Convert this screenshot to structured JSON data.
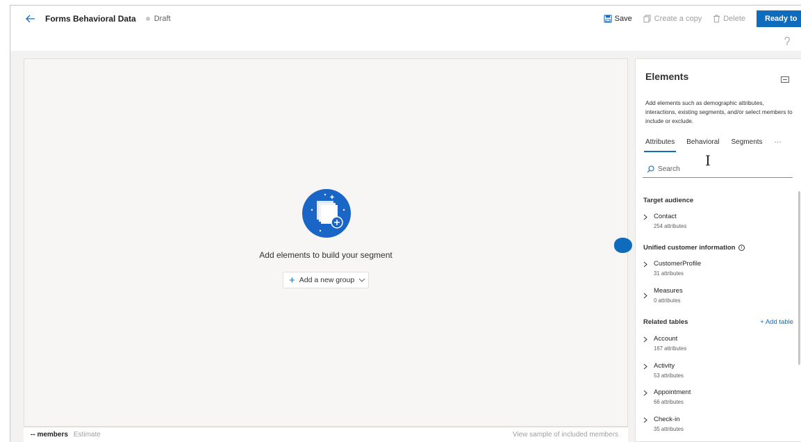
{
  "header": {
    "title": "Forms Behavioral Data",
    "status": "Draft",
    "commands": {
      "save": "Save",
      "copy": "Create a copy",
      "delete": "Delete",
      "ready": "Ready to"
    }
  },
  "canvas": {
    "empty_message": "Add elements to build your segment",
    "add_group": "Add a new group"
  },
  "footer": {
    "members": "-- members",
    "estimate": "Estimate",
    "sample_link": "View sample of included members"
  },
  "panel": {
    "title": "Elements",
    "description": "Add elements such as demographic attributes, interactions, existing segments, and/or select members to include or exclude.",
    "tabs": [
      "Attributes",
      "Behavioral",
      "Segments"
    ],
    "more": "···",
    "search_placeholder": "Search",
    "sections": {
      "target": {
        "title": "Target audience",
        "items": [
          {
            "name": "Contact",
            "sub": "254 attributes"
          }
        ]
      },
      "unified": {
        "title": "Unified customer information",
        "items": [
          {
            "name": "CustomerProfile",
            "sub": "31 attributes"
          },
          {
            "name": "Measures",
            "sub": "0 attributes"
          }
        ]
      },
      "related": {
        "title": "Related tables",
        "add_label": "+ Add table",
        "items": [
          {
            "name": "Account",
            "sub": "167 attributes"
          },
          {
            "name": "Activity",
            "sub": "53 attributes"
          },
          {
            "name": "Appointment",
            "sub": "66 attributes"
          },
          {
            "name": "Check-in",
            "sub": "35 attributes"
          }
        ]
      }
    }
  },
  "colors": {
    "accent": "#0f6cbd",
    "hero": "#1a66c6",
    "workspace": "#f3f2f1"
  },
  "icons": [
    "back-arrow-icon",
    "save-icon",
    "copy-icon",
    "delete-icon",
    "undo-icon",
    "collapse-panel-icon",
    "search-icon",
    "chevron-right-icon",
    "chevron-down-icon",
    "info-icon",
    "add-elements-icon"
  ]
}
